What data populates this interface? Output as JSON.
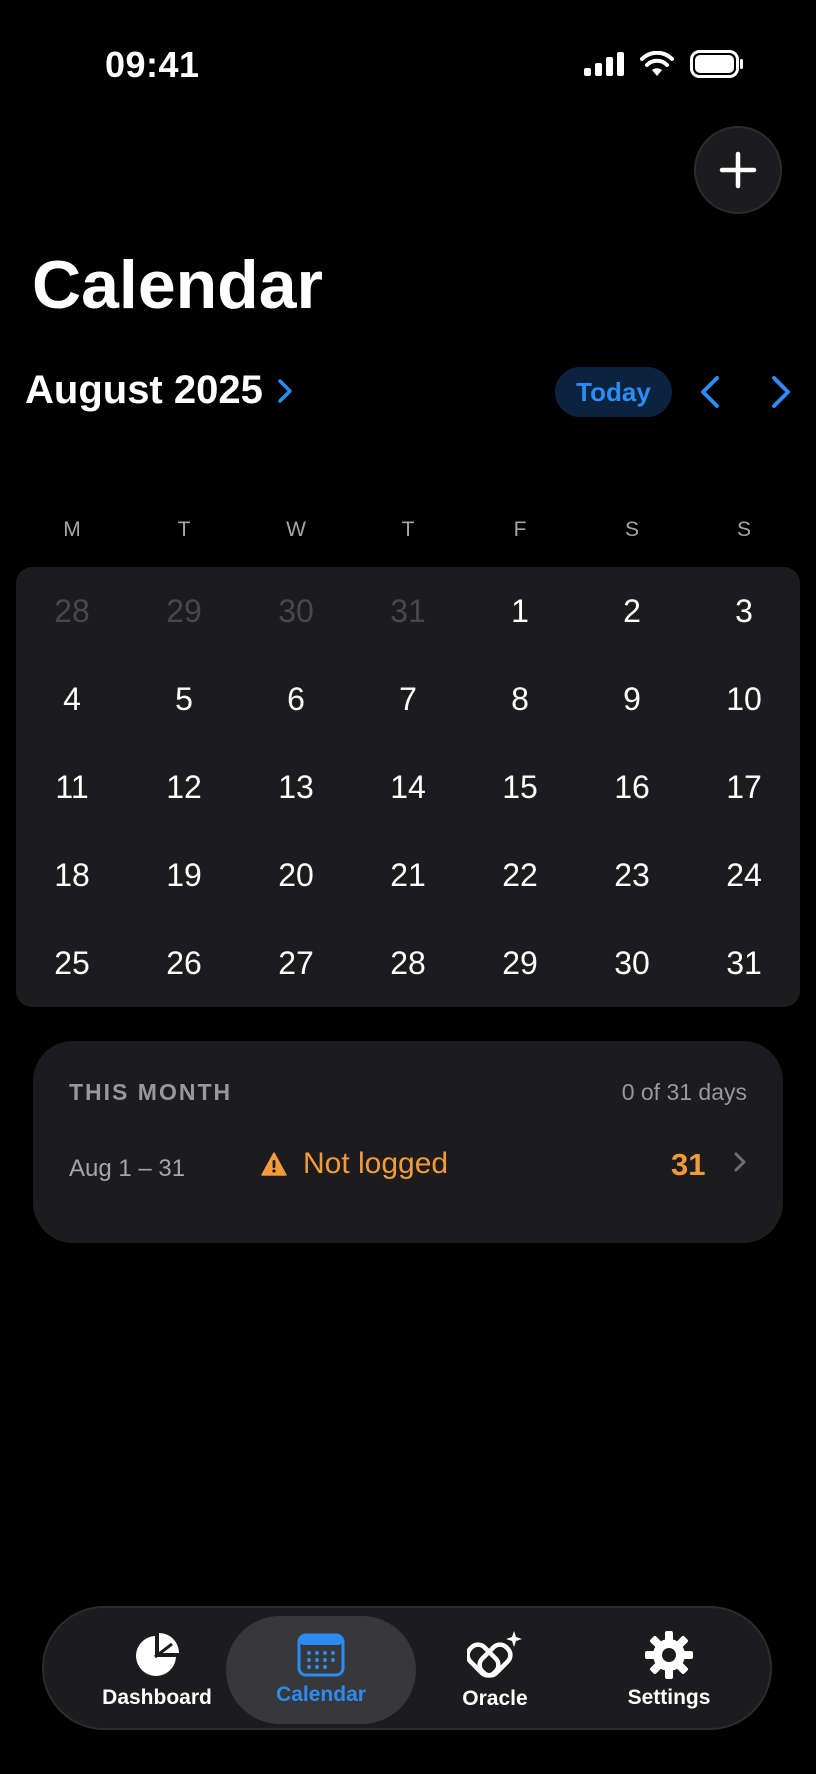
{
  "status_bar": {
    "time": "09:41"
  },
  "header": {
    "title": "Calendar"
  },
  "month_nav": {
    "month_label": "August 2025",
    "today_label": "Today"
  },
  "weekdays": [
    "M",
    "T",
    "W",
    "T",
    "F",
    "S",
    "S"
  ],
  "calendar": {
    "weeks": [
      [
        {
          "d": "28",
          "muted": true
        },
        {
          "d": "29",
          "muted": true
        },
        {
          "d": "30",
          "muted": true
        },
        {
          "d": "31",
          "muted": true
        },
        {
          "d": "1"
        },
        {
          "d": "2"
        },
        {
          "d": "3"
        }
      ],
      [
        {
          "d": "4"
        },
        {
          "d": "5"
        },
        {
          "d": "6"
        },
        {
          "d": "7"
        },
        {
          "d": "8"
        },
        {
          "d": "9"
        },
        {
          "d": "10"
        }
      ],
      [
        {
          "d": "11"
        },
        {
          "d": "12"
        },
        {
          "d": "13"
        },
        {
          "d": "14"
        },
        {
          "d": "15"
        },
        {
          "d": "16"
        },
        {
          "d": "17"
        }
      ],
      [
        {
          "d": "18"
        },
        {
          "d": "19"
        },
        {
          "d": "20"
        },
        {
          "d": "21"
        },
        {
          "d": "22"
        },
        {
          "d": "23"
        },
        {
          "d": "24"
        }
      ],
      [
        {
          "d": "25"
        },
        {
          "d": "26"
        },
        {
          "d": "27"
        },
        {
          "d": "28"
        },
        {
          "d": "29"
        },
        {
          "d": "30"
        },
        {
          "d": "31"
        }
      ]
    ]
  },
  "this_month": {
    "title": "THIS MONTH",
    "count": "0 of 31 days",
    "range": "Aug 1 – 31",
    "status": "Not logged",
    "days": "31"
  },
  "tabs": [
    {
      "label": "Dashboard",
      "icon": "pie-chart-icon",
      "active": false
    },
    {
      "label": "Calendar",
      "icon": "calendar-icon",
      "active": true
    },
    {
      "label": "Oracle",
      "icon": "oracle-sparkle-icon",
      "active": false
    },
    {
      "label": "Settings",
      "icon": "gear-icon",
      "active": false
    }
  ],
  "colors": {
    "accent": "#2b8cf3",
    "warning": "#f39a3b",
    "card": "#1c1c1e",
    "background": "#000000"
  }
}
